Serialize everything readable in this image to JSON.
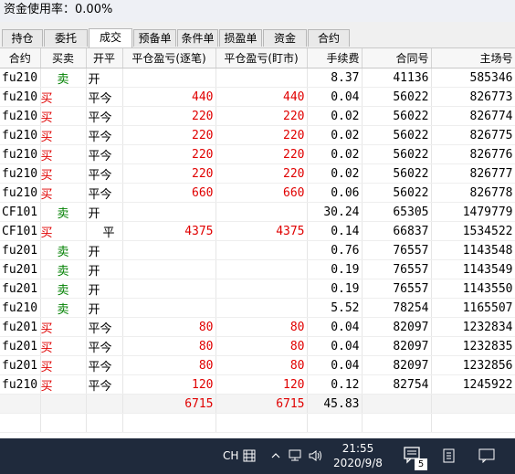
{
  "status": {
    "label": "资金使用率：",
    "value": "0.00%"
  },
  "tabs": [
    "持仓",
    "委托",
    "成交",
    "预备单",
    "条件单",
    "损盈单",
    "资金",
    "合约"
  ],
  "active_tab": 2,
  "columns": [
    "合约",
    "买卖",
    "开平",
    "平仓盈亏(逐笔)",
    "平仓盈亏(盯市)",
    "手续费",
    "合同号",
    "主场号"
  ],
  "rows": [
    {
      "contract": "fu210",
      "side": "卖",
      "open_close": "开",
      "pnl_trade": "",
      "pnl_mark": "",
      "fee": "8.37",
      "contract_no": "41136",
      "match_no": "585346"
    },
    {
      "contract": "fu210",
      "side": "买",
      "open_close": "平今",
      "pnl_trade": "440",
      "pnl_mark": "440",
      "fee": "0.04",
      "contract_no": "56022",
      "match_no": "826773"
    },
    {
      "contract": "fu210",
      "side": "买",
      "open_close": "平今",
      "pnl_trade": "220",
      "pnl_mark": "220",
      "fee": "0.02",
      "contract_no": "56022",
      "match_no": "826774"
    },
    {
      "contract": "fu210",
      "side": "买",
      "open_close": "平今",
      "pnl_trade": "220",
      "pnl_mark": "220",
      "fee": "0.02",
      "contract_no": "56022",
      "match_no": "826775"
    },
    {
      "contract": "fu210",
      "side": "买",
      "open_close": "平今",
      "pnl_trade": "220",
      "pnl_mark": "220",
      "fee": "0.02",
      "contract_no": "56022",
      "match_no": "826776"
    },
    {
      "contract": "fu210",
      "side": "买",
      "open_close": "平今",
      "pnl_trade": "220",
      "pnl_mark": "220",
      "fee": "0.02",
      "contract_no": "56022",
      "match_no": "826777"
    },
    {
      "contract": "fu210",
      "side": "买",
      "open_close": "平今",
      "pnl_trade": "660",
      "pnl_mark": "660",
      "fee": "0.06",
      "contract_no": "56022",
      "match_no": "826778"
    },
    {
      "contract": "CF101",
      "side": "卖",
      "open_close": "开",
      "pnl_trade": "",
      "pnl_mark": "",
      "fee": "30.24",
      "contract_no": "65305",
      "match_no": "1479779"
    },
    {
      "contract": "CF101",
      "side": "买",
      "open_close": "平",
      "pnl_trade": "4375",
      "pnl_mark": "4375",
      "fee": "0.14",
      "contract_no": "66837",
      "match_no": "1534522"
    },
    {
      "contract": "fu201",
      "side": "卖",
      "open_close": "开",
      "pnl_trade": "",
      "pnl_mark": "",
      "fee": "0.76",
      "contract_no": "76557",
      "match_no": "1143548"
    },
    {
      "contract": "fu201",
      "side": "卖",
      "open_close": "开",
      "pnl_trade": "",
      "pnl_mark": "",
      "fee": "0.19",
      "contract_no": "76557",
      "match_no": "1143549"
    },
    {
      "contract": "fu201",
      "side": "卖",
      "open_close": "开",
      "pnl_trade": "",
      "pnl_mark": "",
      "fee": "0.19",
      "contract_no": "76557",
      "match_no": "1143550"
    },
    {
      "contract": "fu210",
      "side": "卖",
      "open_close": "开",
      "pnl_trade": "",
      "pnl_mark": "",
      "fee": "5.52",
      "contract_no": "78254",
      "match_no": "1165507"
    },
    {
      "contract": "fu201",
      "side": "买",
      "open_close": "平今",
      "pnl_trade": "80",
      "pnl_mark": "80",
      "fee": "0.04",
      "contract_no": "82097",
      "match_no": "1232834"
    },
    {
      "contract": "fu201",
      "side": "买",
      "open_close": "平今",
      "pnl_trade": "80",
      "pnl_mark": "80",
      "fee": "0.04",
      "contract_no": "82097",
      "match_no": "1232835"
    },
    {
      "contract": "fu201",
      "side": "买",
      "open_close": "平今",
      "pnl_trade": "80",
      "pnl_mark": "80",
      "fee": "0.04",
      "contract_no": "82097",
      "match_no": "1232856"
    },
    {
      "contract": "fu210",
      "side": "买",
      "open_close": "平今",
      "pnl_trade": "120",
      "pnl_mark": "120",
      "fee": "0.12",
      "contract_no": "82754",
      "match_no": "1245922"
    }
  ],
  "totals": {
    "pnl_trade": "6715",
    "pnl_mark": "6715",
    "fee": "45.83"
  },
  "colors": {
    "buy": "#e00000",
    "sell": "#008000",
    "pnl": "#e00000"
  },
  "taskbar": {
    "ime": "CH",
    "time": "21:55",
    "date": "2020/9/8",
    "notification_count": "5"
  }
}
